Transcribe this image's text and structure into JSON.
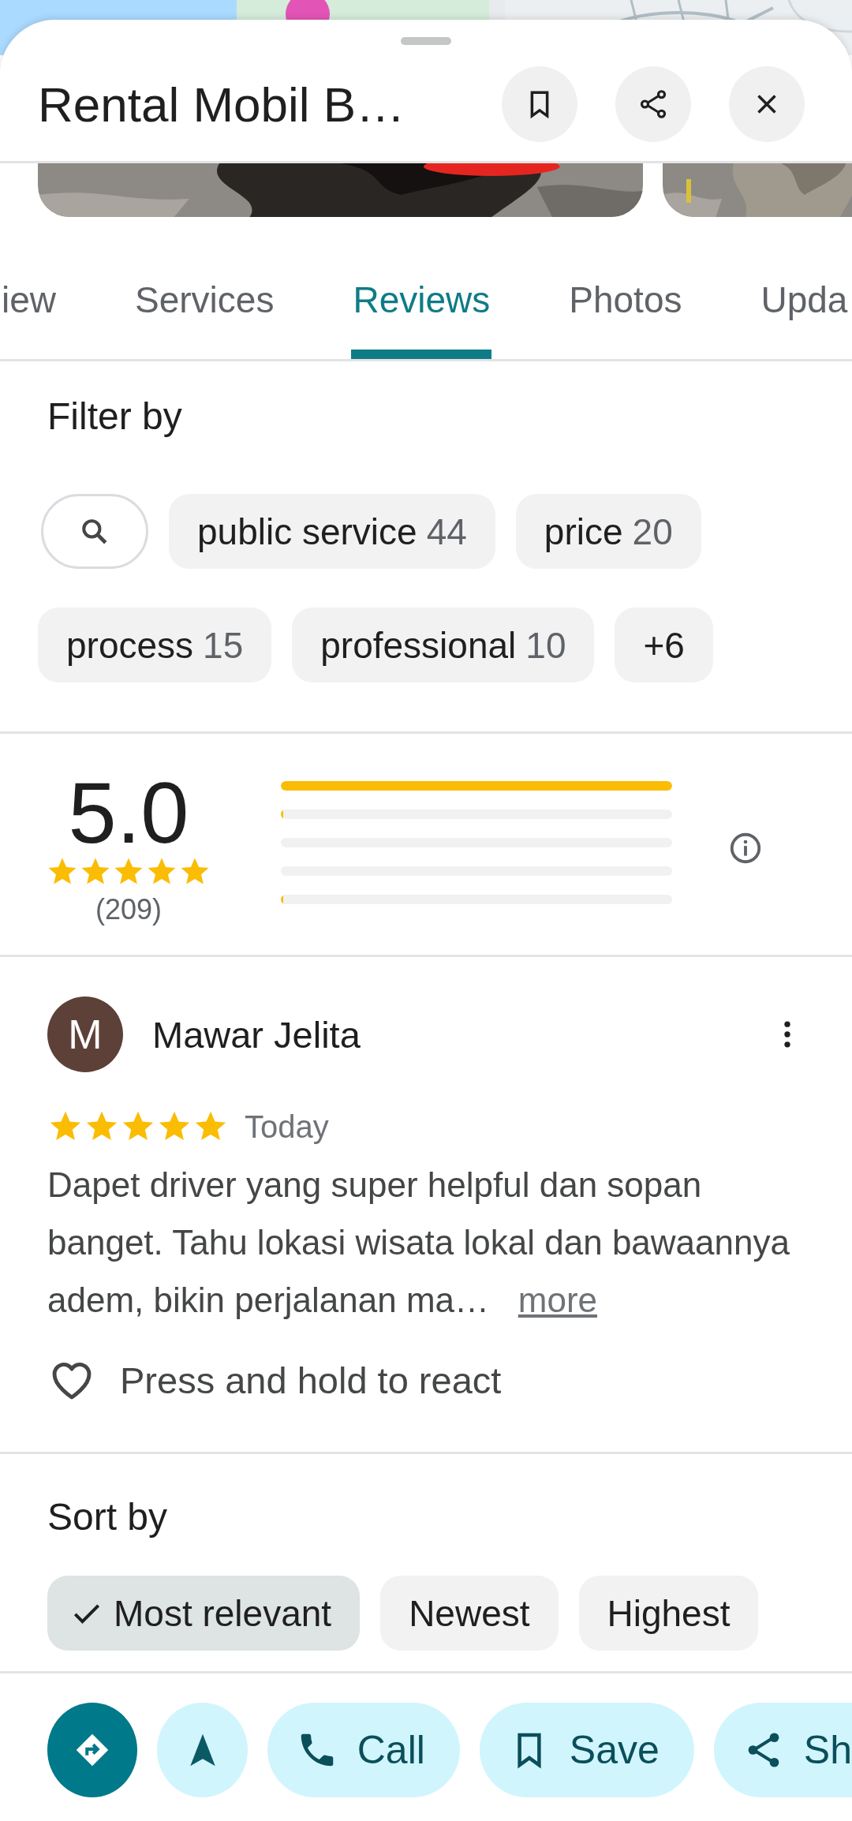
{
  "header": {
    "title": "Rental Mobil B…",
    "buttons": [
      {
        "kind": "save"
      },
      {
        "kind": "share"
      },
      {
        "kind": "close"
      }
    ]
  },
  "tabs": [
    {
      "label": "iew",
      "selected": false
    },
    {
      "label": "Services",
      "selected": false
    },
    {
      "label": "Reviews",
      "selected": true
    },
    {
      "label": "Photos",
      "selected": false
    },
    {
      "label": "Upda",
      "selected": false
    }
  ],
  "filter": {
    "title": "Filter by",
    "chips": [
      {
        "kind": "search"
      },
      {
        "kind": "topic",
        "label": "public service",
        "count": "44"
      },
      {
        "kind": "topic",
        "label": "price",
        "count": "20"
      },
      {
        "kind": "topic",
        "label": "process",
        "count": "15"
      },
      {
        "kind": "topic",
        "label": "professional",
        "count": "10"
      },
      {
        "kind": "more",
        "label": "+6"
      }
    ]
  },
  "rating": {
    "score": "5.0",
    "stars": 5,
    "count": "(209)",
    "bars": [
      {
        "level": 1
      },
      {
        "level": 0.005
      },
      {
        "level": 0
      },
      {
        "level": 0
      },
      {
        "level": 0.005
      }
    ]
  },
  "review": {
    "avatar_letter": "M",
    "author": "Mawar Jelita",
    "stars": 5,
    "date": "Today",
    "text": "Dapet driver yang super helpful dan sopan banget. Tahu lokasi wisata lokal dan bawaannya adem, bikin perjalanan ma…",
    "more": "more",
    "react": "Press and hold to react"
  },
  "sort": {
    "title": "Sort by",
    "options": [
      {
        "label": "Most relevant",
        "selected": true
      },
      {
        "label": "Newest",
        "selected": false
      },
      {
        "label": "Highest",
        "selected": false
      }
    ]
  },
  "actions": [
    {
      "kind": "directions"
    },
    {
      "kind": "start"
    },
    {
      "kind": "call",
      "label": "Call"
    },
    {
      "kind": "save",
      "label": "Save"
    },
    {
      "kind": "share",
      "label": "Sh"
    }
  ]
}
